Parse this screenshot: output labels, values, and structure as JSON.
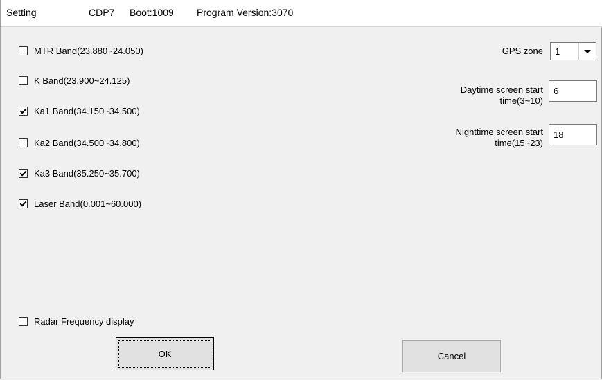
{
  "title": {
    "name": "Setting",
    "model": "CDP7",
    "boot": "Boot:1009",
    "program_version": "Program Version:3070"
  },
  "bands": [
    {
      "label": "MTR Band(23.880~24.050)",
      "checked": false
    },
    {
      "label": "K Band(23.900~24.125)",
      "checked": false
    },
    {
      "label": "Ka1 Band(34.150~34.500)",
      "checked": true
    },
    {
      "label": "Ka2 Band(34.500~34.800)",
      "checked": false
    },
    {
      "label": "Ka3 Band(35.250~35.700)",
      "checked": true
    },
    {
      "label": "Laser Band(0.001~60.000)",
      "checked": true
    }
  ],
  "radar_frequency_display": {
    "label": "Radar Frequency display",
    "checked": false
  },
  "gps_zone": {
    "label": "GPS zone",
    "value": "1"
  },
  "daytime": {
    "label_line1": "Daytime screen start",
    "label_line2": "time(3~10)",
    "value": "6"
  },
  "nighttime": {
    "label_line1": "Nighttime screen start",
    "label_line2": "time(15~23)",
    "value": "18"
  },
  "buttons": {
    "ok": "OK",
    "cancel": "Cancel"
  }
}
